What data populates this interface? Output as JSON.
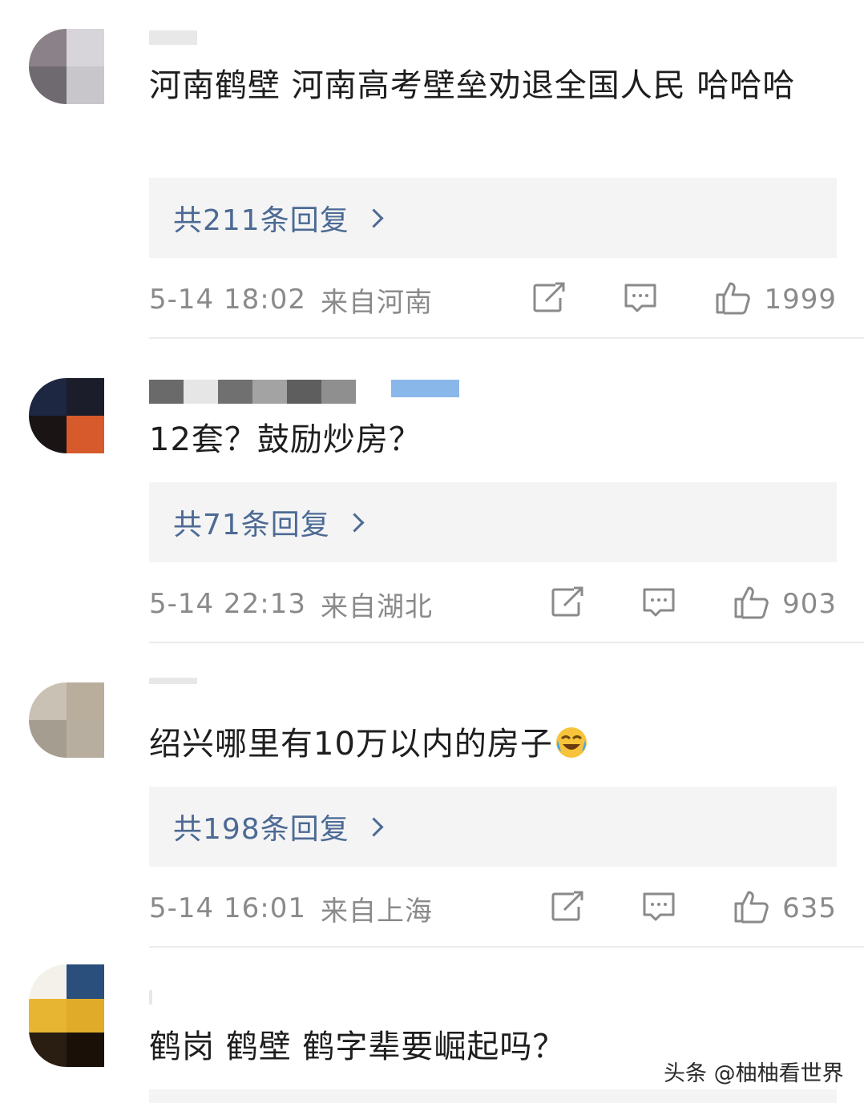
{
  "comments": [
    {
      "text": "河南鹤壁  河南高考壁垒劝退全国人民 哈哈哈",
      "reply_label": "共211条回复",
      "time": "5-14 18:02",
      "location": "来自河南",
      "likes": "1999",
      "avatar_colors": [
        "#8a8288",
        "#d7d5da",
        "#6f6a70",
        "#c9c6cb"
      ]
    },
    {
      "text": "12套？鼓励炒房？",
      "reply_label": "共71条回复",
      "time": "5-14 22:13",
      "location": "来自湖北",
      "likes": "903",
      "avatar_colors": [
        "#1d2742",
        "#1b1e2a",
        "#1a1414",
        "#d65a2b"
      ]
    },
    {
      "text": "绍兴哪里有10万以内的房子",
      "reply_label": "共198条回复",
      "time": "5-14 16:01",
      "location": "来自上海",
      "likes": "635",
      "avatar_colors": [
        "#c9c1b4",
        "#b9ad9c",
        "#a69d91",
        "#b8ae9f"
      ]
    },
    {
      "text": "鹤岗 鹤壁  鹤字辈要崛起吗？",
      "avatar_colors": [
        "#f3f1ea",
        "#2a4f7c",
        "#e8b532",
        "#e1ab2a"
      ]
    }
  ],
  "icons": {
    "share": "share-icon",
    "comment": "comment-icon",
    "like": "thumbs-up-icon",
    "chevron": "chevron-right-icon",
    "emoji": "laughing-crying-emoji-icon"
  },
  "colors": {
    "reply_link": "#4c6a94",
    "meta_text": "#8a8a8a",
    "reply_bg": "#f4f4f4"
  },
  "watermark": "头条 @柚柚看世界"
}
